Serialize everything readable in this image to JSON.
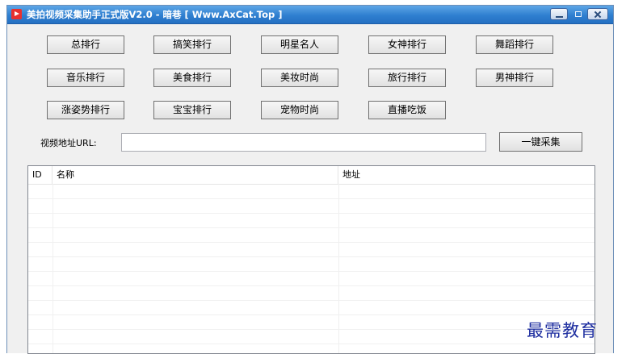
{
  "window": {
    "title": "美拍视频采集助手正式版V2.0 - 暗巷 [ Www.AxCat.Top ]",
    "icons": {
      "app": "video-app-icon",
      "minimize": "minimize-icon",
      "maximize": "maximize-icon",
      "close": "close-icon"
    }
  },
  "categories": {
    "row1": [
      "总排行",
      "搞笑排行",
      "明星名人",
      "女神排行",
      "舞蹈排行"
    ],
    "row2": [
      "音乐排行",
      "美食排行",
      "美妆时尚",
      "旅行排行",
      "男神排行"
    ],
    "row3": [
      "涨姿势排行",
      "宝宝排行",
      "宠物时尚",
      "直播吃饭"
    ]
  },
  "url": {
    "label": "视频地址URL:",
    "value": "",
    "button": "一键采集"
  },
  "table": {
    "columns": [
      "ID",
      "名称",
      "地址"
    ],
    "rows": []
  },
  "watermark": "最需教育",
  "colors": {
    "titlebar": "#2f7fd0",
    "window_bg": "#f0f0f0",
    "watermark": "#1f2fa0"
  }
}
